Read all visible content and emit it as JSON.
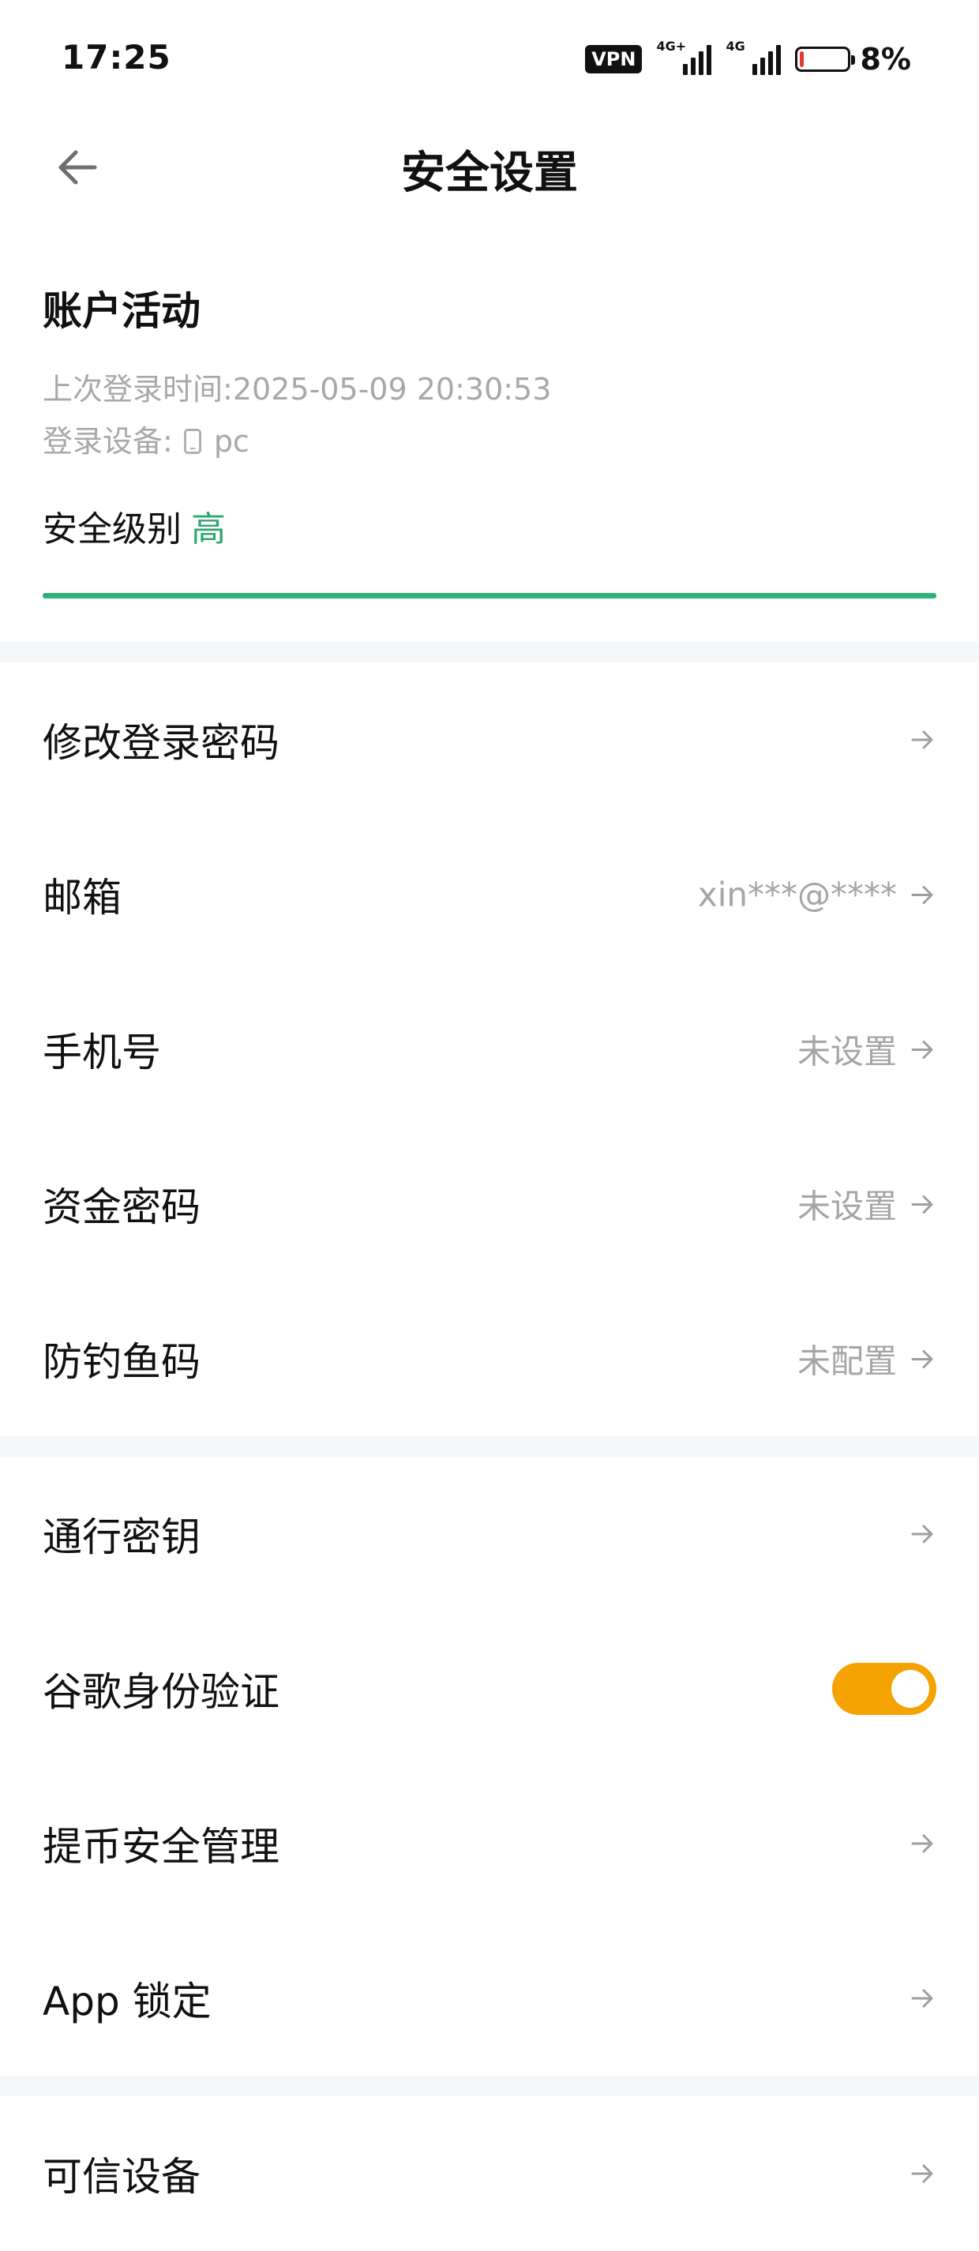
{
  "status_bar": {
    "time": "17:25",
    "vpn": "VPN",
    "signal1_tag": "4G+",
    "signal2_tag": "4G",
    "battery_percent": "8%",
    "battery_level": 0.08,
    "battery_color": "#e53935"
  },
  "header": {
    "title": "安全设置",
    "back_icon": "arrow-left-icon"
  },
  "activity": {
    "title": "账户活动",
    "last_login_label": "上次登录时间: ",
    "last_login_time": "2025-05-09 20:30:53",
    "device_label": "登录设备: ",
    "device_name": "pc",
    "security_level_label": "安全级别",
    "security_level_value": "高",
    "security_level_color": "#2ea670"
  },
  "section1": {
    "items": [
      {
        "label": "修改登录密码",
        "value": ""
      },
      {
        "label": "邮箱",
        "value": "xin***@****"
      },
      {
        "label": "手机号",
        "value": "未设置"
      },
      {
        "label": "资金密码",
        "value": "未设置"
      },
      {
        "label": "防钓鱼码",
        "value": "未配置"
      }
    ]
  },
  "section2": {
    "items": [
      {
        "label": "通行密钥",
        "value": ""
      },
      {
        "label": "谷歌身份验证",
        "toggle_on": true
      },
      {
        "label": "提币安全管理",
        "value": ""
      },
      {
        "label": "App 锁定",
        "value": ""
      }
    ]
  },
  "section3": {
    "items": [
      {
        "label": "可信设备",
        "value": ""
      }
    ]
  },
  "colors": {
    "accent_green": "#2fb27a",
    "toggle_on": "#f5a300",
    "muted_text": "#a5a5a5",
    "section_gap": "#f5f6fa"
  }
}
